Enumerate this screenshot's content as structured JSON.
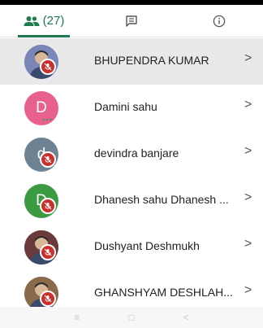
{
  "tabs": {
    "people_count": "(27)",
    "chat_icon": "chat-icon",
    "info_icon": "info-icon"
  },
  "participants": [
    {
      "name": "BHUPENDRA KUMAR",
      "avatar_type": "photo",
      "avatar_color": "#7a86b8",
      "muted": true,
      "active": true
    },
    {
      "name": "Damini sahu",
      "avatar_type": "initial",
      "initial": "D",
      "avatar_color": "#e8608c",
      "muted": false,
      "talking": "..."
    },
    {
      "name": "devindra banjare",
      "avatar_type": "initial",
      "initial": "d",
      "avatar_color": "#6d8293",
      "muted": true
    },
    {
      "name": "Dhanesh sahu Dhanesh ...",
      "avatar_type": "initial",
      "initial": "D",
      "avatar_color": "#3c9a43",
      "muted": true
    },
    {
      "name": "Dushyant Deshmukh",
      "avatar_type": "photo",
      "avatar_color": "#6b3b3b",
      "muted": true
    },
    {
      "name": "GHANSHYAM DESHLAH...",
      "avatar_type": "photo",
      "avatar_color": "#8a6a4a",
      "muted": true
    }
  ],
  "chevron": ">",
  "navbar": {
    "menu": "≡",
    "home": "□",
    "back": "<"
  },
  "colors": {
    "accent": "#1f7a4f",
    "mute": "#c9302c",
    "active_row": "#e9e9e9"
  }
}
